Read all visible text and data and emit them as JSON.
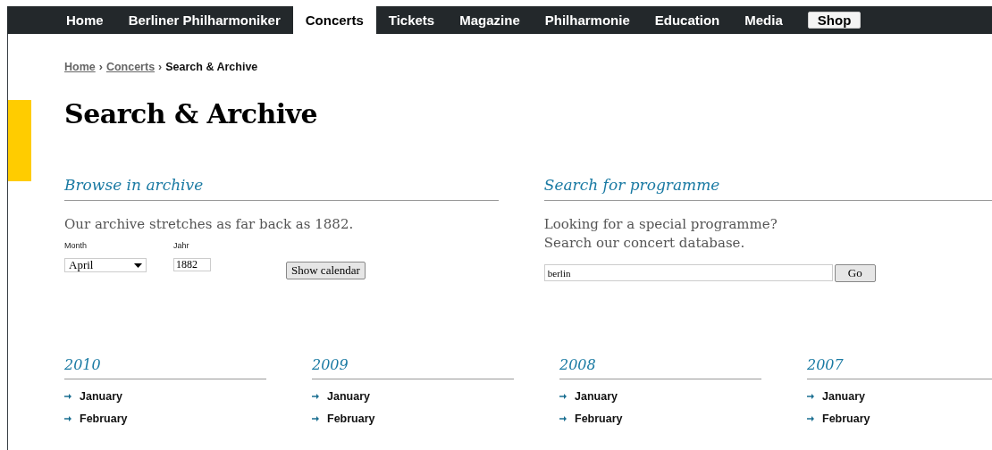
{
  "nav": [
    {
      "label": "Home",
      "selected": false,
      "kind": "tab"
    },
    {
      "label": "Berliner Philharmoniker",
      "selected": false,
      "kind": "tab"
    },
    {
      "label": "Concerts",
      "selected": true,
      "kind": "tab"
    },
    {
      "label": "Tickets",
      "selected": false,
      "kind": "tab"
    },
    {
      "label": "Magazine",
      "selected": false,
      "kind": "tab"
    },
    {
      "label": "Philharmonie",
      "selected": false,
      "kind": "tab"
    },
    {
      "label": "Education",
      "selected": false,
      "kind": "tab"
    },
    {
      "label": "Media",
      "selected": false,
      "kind": "tab"
    },
    {
      "label": "Shop",
      "selected": false,
      "kind": "button"
    }
  ],
  "breadcrumb": {
    "links": [
      "Home",
      "Concerts"
    ],
    "separator": "›",
    "current": "Search & Archive"
  },
  "title": "Search & Archive",
  "browse": {
    "heading": "Browse in archive",
    "text": "Our archive stretches as far back as 1882.",
    "month_label": "Month",
    "month_value": "April",
    "year_label": "Jahr",
    "year_value": "1882",
    "button": "Show calendar"
  },
  "search": {
    "heading": "Search for programme",
    "text": [
      "Looking for a special programme?",
      "Search our concert database."
    ],
    "value": "berlin",
    "button": "Go"
  },
  "years": [
    {
      "year": "2010",
      "months": [
        "January",
        "February"
      ]
    },
    {
      "year": "2009",
      "months": [
        "January",
        "February"
      ]
    },
    {
      "year": "2008",
      "months": [
        "January",
        "February"
      ]
    },
    {
      "year": "2007",
      "months": [
        "January",
        "February"
      ]
    }
  ]
}
